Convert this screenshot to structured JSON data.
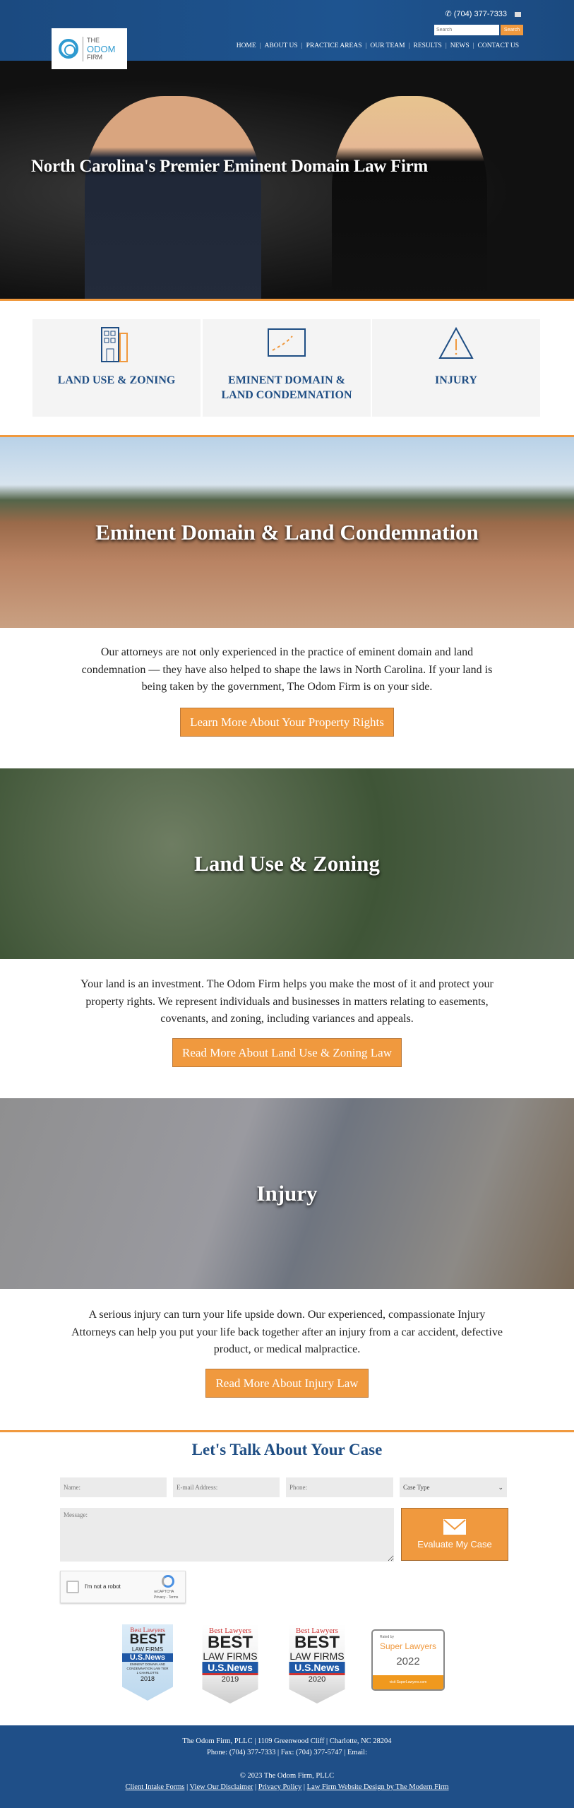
{
  "header": {
    "logo": {
      "line1": "THE",
      "line2": "ODOM",
      "line3": "FIRM"
    },
    "phone": "(704) 377-7333",
    "search_placeholder": "Search",
    "search_button": "Search",
    "nav": [
      "HOME",
      "ABOUT US",
      "PRACTICE AREAS",
      "OUR TEAM",
      "RESULTS",
      "NEWS",
      "CONTACT US"
    ]
  },
  "hero": {
    "title": "North Carolina's Premier Eminent Domain Law Firm"
  },
  "practice_cards": [
    {
      "label": "LAND USE & ZONING",
      "icon": "building-icon"
    },
    {
      "label": "EMINENT DOMAIN & LAND CONDEMNATION",
      "icon": "map-icon"
    },
    {
      "label": "INJURY",
      "icon": "warning-icon"
    }
  ],
  "sections": [
    {
      "title": "Eminent Domain & Land Condemnation",
      "body": "Our attorneys are not only experienced in the practice of eminent domain and land condemnation — they have also helped to shape the laws in North Carolina. If your land is being taken by the government, The Odom Firm is on your side.",
      "button": "Learn More About Your Property Rights"
    },
    {
      "title": "Land Use & Zoning",
      "body": "Your land is an investment. The Odom Firm helps you make the most of it and protect your property rights. We represent individuals and businesses in matters relating to easements, covenants, and zoning, including variances and appeals.",
      "button": "Read More About Land Use & Zoning Law"
    },
    {
      "title": "Injury",
      "body": "A serious injury can turn your life upside down. Our experienced, compassionate Injury Attorneys can help you put your life back together after an injury from a car accident, defective product, or medical malpractice.",
      "button": "Read More About Injury Law"
    }
  ],
  "contact": {
    "title": "Let's Talk About Your Case",
    "name_placeholder": "Name:",
    "email_placeholder": "E-mail Address:",
    "phone_placeholder": "Phone:",
    "case_type": "Case Type",
    "message_placeholder": "Message:",
    "submit": "Evaluate My Case",
    "captcha_label": "I'm not a robot",
    "captcha_brand": "reCAPTCHA",
    "captcha_links": "Privacy - Terms"
  },
  "badges": [
    {
      "top": "Best Lawyers",
      "main": "BEST",
      "sub": "LAW FIRMS",
      "brand": "U.S.News",
      "detail": "EMINENT DOMAIN AND CONDEMNATION LAW TIER 1 CHARLOTTE",
      "year": "2018"
    },
    {
      "top": "Best Lawyers",
      "main": "BEST",
      "sub": "LAW FIRMS",
      "brand": "U.S.News",
      "year": "2019"
    },
    {
      "top": "Best Lawyers",
      "main": "BEST",
      "sub": "LAW FIRMS",
      "brand": "U.S.News",
      "year": "2020"
    },
    {
      "top": "Rated by",
      "main": "Super Lawyers",
      "year": "2022",
      "footer": "visit SuperLawyers.com"
    }
  ],
  "footer": {
    "line1": "The Odom Firm, PLLC  |  1109 Greenwood Cliff  |  Charlotte, NC 28204",
    "line2": "Phone: (704) 377-7333  |  Fax: (704) 377-5747  |  Email:",
    "copyright": "© 2023 The Odom Firm, PLLC",
    "links": [
      "Client Intake Forms",
      "View Our Disclaimer",
      "Privacy Policy",
      "Law Firm Website Design by The Modern Firm"
    ]
  },
  "colors": {
    "brand_blue": "#1f4e84",
    "accent_orange": "#f0993e"
  }
}
